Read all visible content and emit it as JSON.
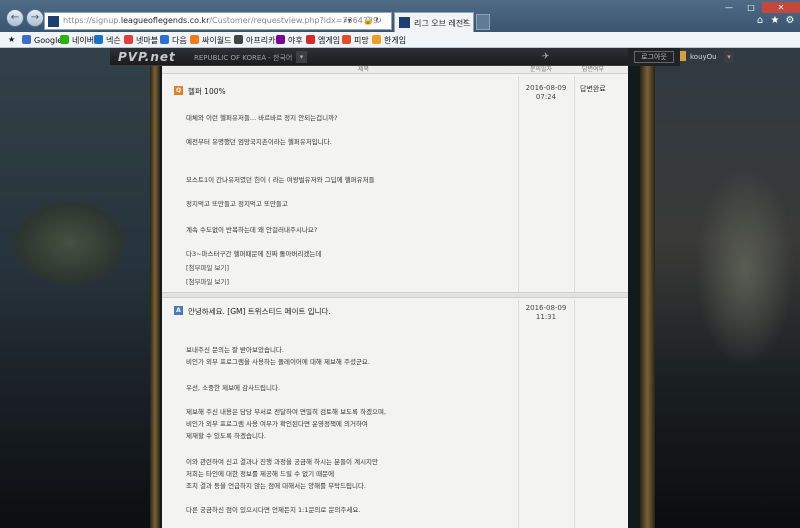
{
  "browser": {
    "url_prefix": "https://signup.",
    "url_domain": "leagueoflegends.co.kr",
    "url_path": "/Customer/requestview.php?idx=7364739",
    "tab_title": "리그 오브 레전드",
    "window_controls": {
      "minimize": "—",
      "maximize": "□",
      "close": "✕"
    },
    "favorites": [
      {
        "label": "Google",
        "color": "#3a6fc9"
      },
      {
        "label": "네이버",
        "color": "#2db400"
      },
      {
        "label": "넥슨",
        "color": "#1a73c9"
      },
      {
        "label": "넷마블",
        "color": "#e04040"
      },
      {
        "label": "다음",
        "color": "#2f6fd2"
      },
      {
        "label": "싸이월드",
        "color": "#f07d1a"
      },
      {
        "label": "아프리카",
        "color": "#444444"
      },
      {
        "label": "야후",
        "color": "#7b0099"
      },
      {
        "label": "엠게임",
        "color": "#d62a2a"
      },
      {
        "label": "피망",
        "color": "#e64b2a"
      },
      {
        "label": "한게임",
        "color": "#f0a020"
      }
    ]
  },
  "site": {
    "logo": "PVP.net",
    "region": "REPUBLIC OF KOREA - 한국어",
    "username": "kouyOu",
    "logout_label": "로그아웃",
    "header_cols": [
      "제목",
      "문의일자",
      "답변여부"
    ]
  },
  "question": {
    "badge": "Q",
    "badge_color": "#e0812a",
    "title": "헬퍼 100%",
    "date": "2016-08-09",
    "time": "07:24",
    "status": "답변완료",
    "lines": [
      "대체와 이런 헬퍼유저들... 바르바르 정지 안되는겁니까?",
      "예전부터 유명했던 엄망국지촌이라는 헬퍼유저입니다.",
      "",
      "모스트1이 간나유저였던 힌이 ( 라는 여왕벌유저와 그딥에 헬퍼유저들",
      "정지먹고 또만들고 정지먹고 또만들고",
      "계속 수도없이 반복하는데 왜 안걸러내주시나요?",
      "다3~마스터구간 헬퍼때문에 진짜 돌아버리겠는데",
      "[첨부파일 보기]",
      "[첨부파일 보기]"
    ]
  },
  "answer": {
    "badge": "A",
    "badge_color": "#4a7ab8",
    "title": "안녕하세요. [GM] 트위스티드 페이트 입니다.",
    "date": "2016-08-09",
    "time": "11:31",
    "lines": [
      "보내주신 문의는 잘 받아보았습니다.",
      "비인가 외부 프로그램을 사용하는 플레이어에 대해 제보해 주셨군요.",
      "우선, 소중한 제보에 감사드립니다.",
      "제보해 주신 내용은 담당 부서로 전달하여 면밀히 검토해 보도록 하겠으며,",
      "비인가 외부 프로그램 사용 여부가 확인된다면 운영정책에 의거하여",
      "제재할 수 있도록 하겠습니다.",
      "이와 관련하여 신고 결과나 진행 과정을 궁금해 하시는 분들이 계시지만",
      "저희는 타인에 대한 정보를 제공해 드릴 수 없기 때문에",
      "조치 결과 등을 언급하지 않는 점에 대해서는 양해를 부탁드립니다.",
      "다른 궁금하신 점이 있으시다면 언제든지 1:1문의로 문의주세요."
    ]
  }
}
